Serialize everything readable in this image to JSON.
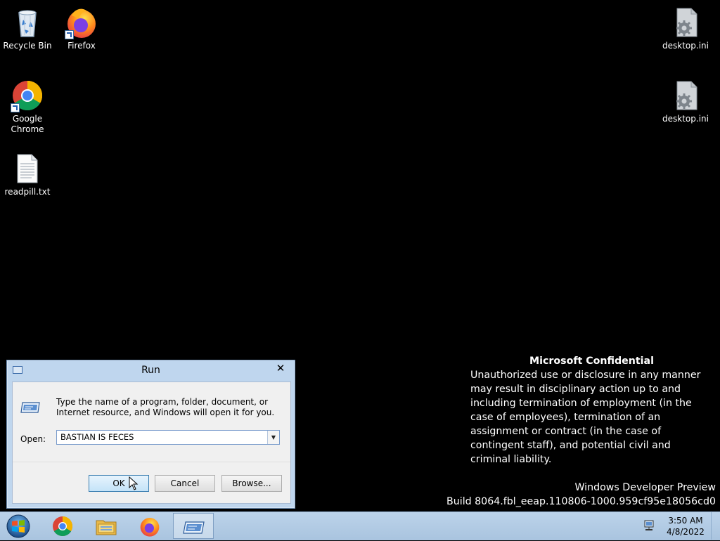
{
  "desktop": {
    "icons": [
      {
        "label": "Recycle Bin"
      },
      {
        "label": "Firefox"
      },
      {
        "label": "Google Chrome"
      },
      {
        "label": "readpill.txt"
      },
      {
        "label": "desktop.ini"
      },
      {
        "label": "desktop.ini"
      }
    ],
    "watermark": {
      "title": "Microsoft Confidential",
      "body": "Unauthorized use or disclosure in any manner may result in disciplinary action up to and including termination of employment (in the case of employees), termination of an assignment or contract (in the case of contingent staff), and potential civil and criminal liability.",
      "edition": "Windows Developer Preview",
      "build": "Build 8064.fbl_eeap.110806-1000.959cf95e18056cd0"
    }
  },
  "run_dialog": {
    "title": "Run",
    "close_glyph": "✕",
    "instructions": "Type the name of a program, folder, document, or Internet resource, and Windows will open it for you.",
    "open_label": "Open:",
    "open_value": "BASTIAN IS FECES",
    "buttons": {
      "ok": "OK",
      "cancel": "Cancel",
      "browse": "Browse..."
    }
  },
  "taskbar": {
    "pinned": [
      "chrome-icon",
      "file-explorer-icon",
      "firefox-icon",
      "run-icon"
    ],
    "clock": {
      "time": "3:50 AM",
      "date": "4/8/2022"
    }
  },
  "colors": {
    "desktop_background": "#000000",
    "taskbar": "#b4cce6",
    "dialog_frame": "#bfd6ee"
  }
}
